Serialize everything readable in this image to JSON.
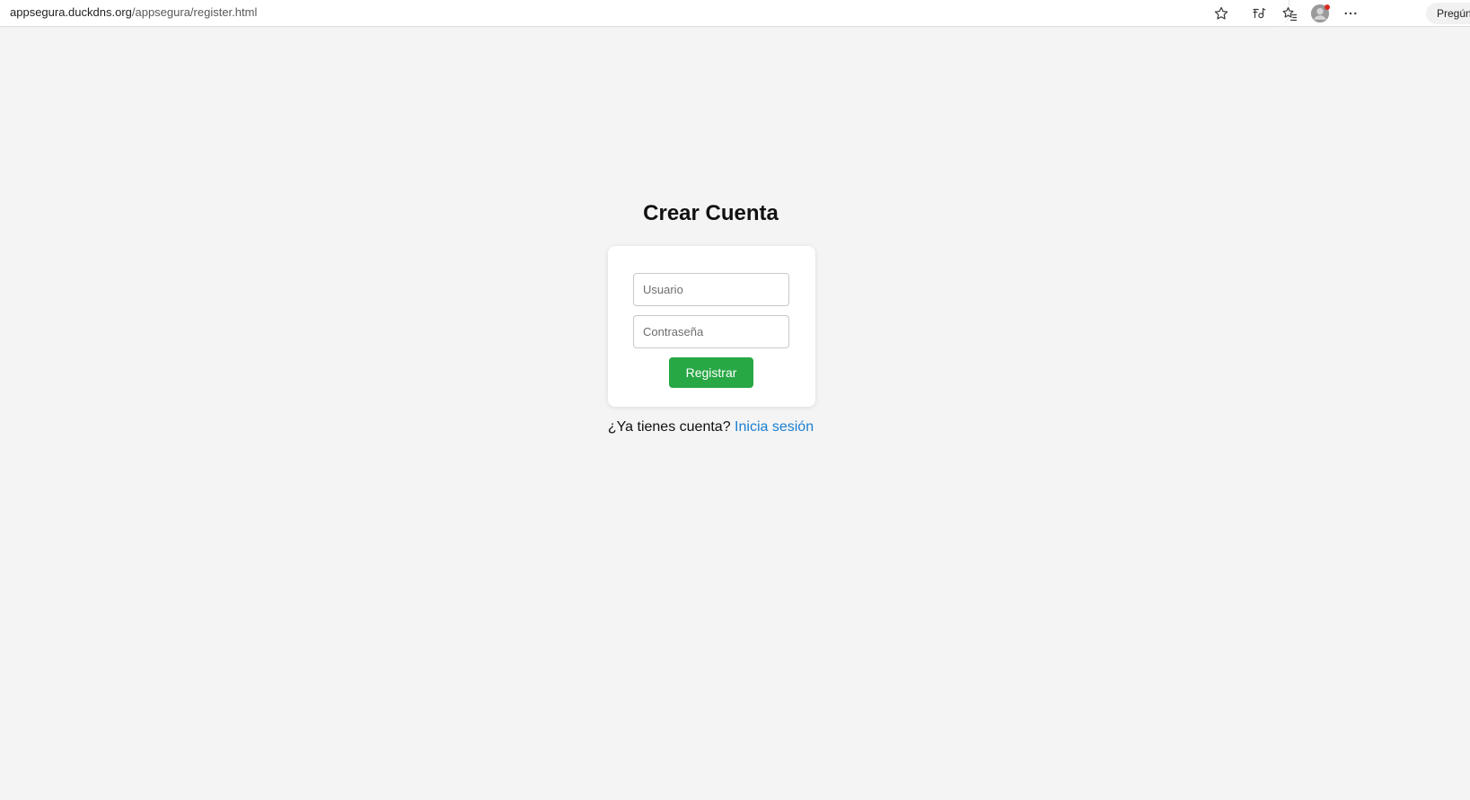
{
  "browser": {
    "url_host": "appsegura.duckdns.org",
    "url_path": "/appsegura/register.html",
    "ask_button_label": "Pregúntale a Copilot",
    "icons": {
      "favorite": "star-icon",
      "read_aloud": "read-aloud-icon",
      "favorites_list": "favorites-icon",
      "profile": "profile-avatar-icon",
      "more": "more-options-icon"
    },
    "colors": {
      "notification_dot": "#d92a1e"
    }
  },
  "page": {
    "title": "Crear Cuenta",
    "form": {
      "username_placeholder": "Usuario",
      "username_value": "",
      "password_placeholder": "Contraseña",
      "password_value": "",
      "submit_label": "Registrar"
    },
    "footer": {
      "prompt": "¿Ya tienes cuenta?",
      "link_label": "Inicia sesión"
    },
    "colors": {
      "background": "#f4f4f4",
      "button": "#28a745",
      "link": "#1a7fd1"
    }
  }
}
